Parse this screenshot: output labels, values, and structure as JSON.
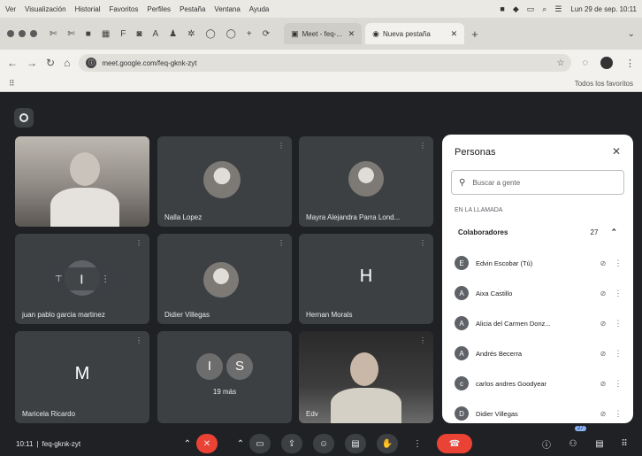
{
  "menubar": {
    "items": [
      "Ver",
      "Visualización",
      "Historial",
      "Favoritos",
      "Perfiles",
      "Pestaña",
      "Ventana",
      "Ayuda"
    ],
    "clock": "Lun 29 de sep. 10:11"
  },
  "browser": {
    "tabs": [
      {
        "title": "Meet - feq-..."
      },
      {
        "title": "Nueva pestaña"
      }
    ],
    "url": "meet.google.com/feq-gknk-zyt",
    "bookmarks_right": "Todos los favoritos"
  },
  "meet": {
    "tiles": [
      {
        "name": ""
      },
      {
        "name": "Nalla Lopez"
      },
      {
        "name": "Mayra Alejandra Parra Lond..."
      },
      {
        "name": "juan pablo garcia martinez"
      },
      {
        "name": "Didier Villegas"
      },
      {
        "name": "Hernan Morals",
        "initial": "H"
      },
      {
        "name": "Maricela Ricardo",
        "initial": "M"
      },
      {
        "name": "",
        "initials": [
          "I",
          "S"
        ],
        "more": "19 más"
      },
      {
        "name": "Edv"
      }
    ],
    "meeting_time": "10:11",
    "meeting_code": "feq-gknk-zyt",
    "people_count": "27"
  },
  "people_panel": {
    "title": "Personas",
    "search_placeholder": "Buscar a gente",
    "in_call_label": "EN LA LLAMADA",
    "group_label": "Colaboradores",
    "group_count": "27",
    "people": [
      {
        "name": "Edvin Escobar (Tú)",
        "initial": "E"
      },
      {
        "name": "Aixa Castillo",
        "initial": "A"
      },
      {
        "name": "Alicia del Carmen Donz...",
        "initial": "A"
      },
      {
        "name": "Andrés Becerra",
        "initial": "A"
      },
      {
        "name": "carlos andres Goodyear",
        "initial": "c"
      },
      {
        "name": "Didier Villegas",
        "initial": "D"
      }
    ]
  }
}
